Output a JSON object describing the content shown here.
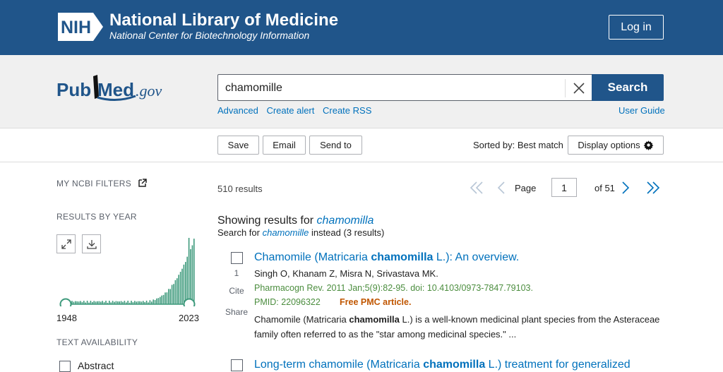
{
  "header": {
    "nih_logo_text": "NIH",
    "title": "National Library of Medicine",
    "subtitle": "National Center for Biotechnology Information",
    "login_label": "Log in",
    "brand_color": "#20558a"
  },
  "search": {
    "logo_text_pub": "Pub",
    "logo_text_med": "Med",
    "logo_text_gov": ".gov",
    "query": "chamomille",
    "search_label": "Search",
    "links": [
      "Advanced",
      "Create alert",
      "Create RSS"
    ],
    "user_guide": "User Guide"
  },
  "toolbar": {
    "save": "Save",
    "email": "Email",
    "send_to": "Send to",
    "sorted_by": "Sorted by: Best match",
    "display_options": "Display options"
  },
  "sidebar": {
    "my_filters": "MY NCBI FILTERS",
    "results_by_year": "RESULTS BY YEAR",
    "year_start": "1948",
    "year_end": "2023",
    "text_availability": "TEXT AVAILABILITY",
    "filter_abstract": "Abstract",
    "histogram_color": "#3e9a7c"
  },
  "results": {
    "count": "510 results",
    "page_label": "Page",
    "page_value": "1",
    "page_of": "of 51",
    "showing_prefix": "Showing results for ",
    "showing_term": "chamomilla",
    "instead_prefix": "Search for ",
    "instead_term": "chamomille",
    "instead_suffix": " instead (3 results)",
    "articles": [
      {
        "number": "1",
        "cite": "Cite",
        "share": "Share",
        "title_a": "Chamomile (Matricaria ",
        "title_b": "chamomilla",
        "title_c": " L.): An overview.",
        "authors": "Singh O, Khanam Z, Misra N, Srivastava MK.",
        "citation": "Pharmacogn Rev. 2011 Jan;5(9):82-95. doi: 10.4103/0973-7847.79103.",
        "pmid": "PMID: 22096322",
        "free": "Free PMC article.",
        "snippet_a": "Chamomile (Matricaria ",
        "snippet_b": "chamomilla",
        "snippet_c": " L.) is a well-known medicinal plant species from the Asteraceae family often referred to as the \"star among medicinal species.\" ..."
      },
      {
        "title_a": "Long-term chamomile (Matricaria ",
        "title_b": "chamomilla",
        "title_c": " L.) treatment for generalized"
      }
    ]
  }
}
